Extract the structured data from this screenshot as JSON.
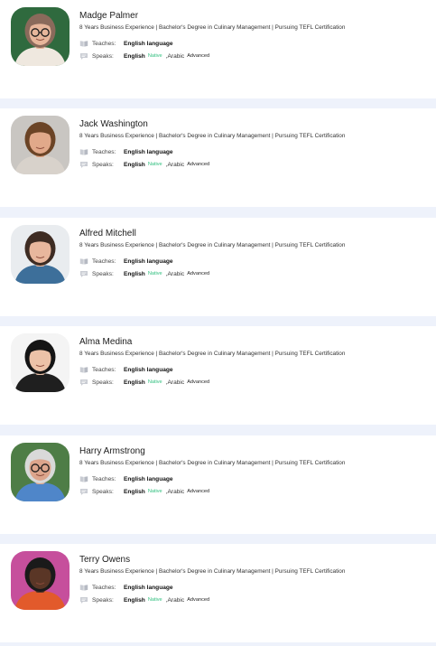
{
  "labels": {
    "teaches": "Teaches:",
    "speaks": "Speaks:",
    "separator": ",Arabic"
  },
  "tutors": [
    {
      "name": "Madge Palmer",
      "headline": "8 Years Business Experience | Bachelor's Degree in Culinary Management | Pursuing TEFL Certification",
      "teaches": "English language",
      "speaks_primary": "English",
      "primary_level": "Native",
      "secondary_level": "Advanced",
      "avatar": {
        "bg": "#2f6a3e",
        "skin": "#e7b69b",
        "hair": "#8a6a5b",
        "shirt": "#efe8df",
        "glasses": true
      }
    },
    {
      "name": "Jack Washington",
      "headline": "8 Years Business Experience | Bachelor's Degree in Culinary Management | Pursuing TEFL Certification",
      "teaches": "English language",
      "speaks_primary": "English",
      "primary_level": "Native",
      "secondary_level": "Advanced",
      "avatar": {
        "bg": "#c9c6c2",
        "skin": "#e1a98a",
        "hair": "#6b4426",
        "shirt": "#d8d2cb",
        "glasses": false
      }
    },
    {
      "name": "Alfred Mitchell",
      "headline": "8 Years Business Experience | Bachelor's Degree in Culinary Management | Pursuing TEFL Certification",
      "teaches": "English language",
      "speaks_primary": "English",
      "primary_level": "Native",
      "secondary_level": "Advanced",
      "avatar": {
        "bg": "#e9ecef",
        "skin": "#e8b79d",
        "hair": "#3e2c23",
        "shirt": "#3d6f9a",
        "glasses": false
      }
    },
    {
      "name": "Alma Medina",
      "headline": "8 Years Business Experience | Bachelor's Degree in Culinary Management | Pursuing TEFL Certification",
      "teaches": "English language",
      "speaks_primary": "English",
      "primary_level": "Native",
      "secondary_level": "Advanced",
      "avatar": {
        "bg": "#f4f4f4",
        "skin": "#ecc2a8",
        "hair": "#151515",
        "shirt": "#1f1f1f",
        "glasses": false
      }
    },
    {
      "name": "Harry Armstrong",
      "headline": "8 Years Business Experience | Bachelor's Degree in Culinary Management | Pursuing TEFL Certification",
      "teaches": "English language",
      "speaks_primary": "English",
      "primary_level": "Native",
      "secondary_level": "Advanced",
      "avatar": {
        "bg": "#4e7d46",
        "skin": "#dca58c",
        "hair": "#d9d9d9",
        "shirt": "#4f86c9",
        "glasses": true
      }
    },
    {
      "name": "Terry Owens",
      "headline": "8 Years Business Experience | Bachelor's Degree in Culinary Management | Pursuing TEFL Certification",
      "teaches": "English language",
      "speaks_primary": "English",
      "primary_level": "Native",
      "secondary_level": "Advanced",
      "avatar": {
        "bg": "#c64f9c",
        "skin": "#5a3626",
        "hair": "#1a1a1a",
        "shirt": "#e25a2b",
        "glasses": false
      }
    }
  ],
  "colors": {
    "page_bg": "#eef2fb",
    "card_bg": "#ffffff",
    "native_accent": "#2fbf7e"
  },
  "icons": {
    "teaches": "book-icon",
    "speaks": "chat-bubble-icon"
  }
}
